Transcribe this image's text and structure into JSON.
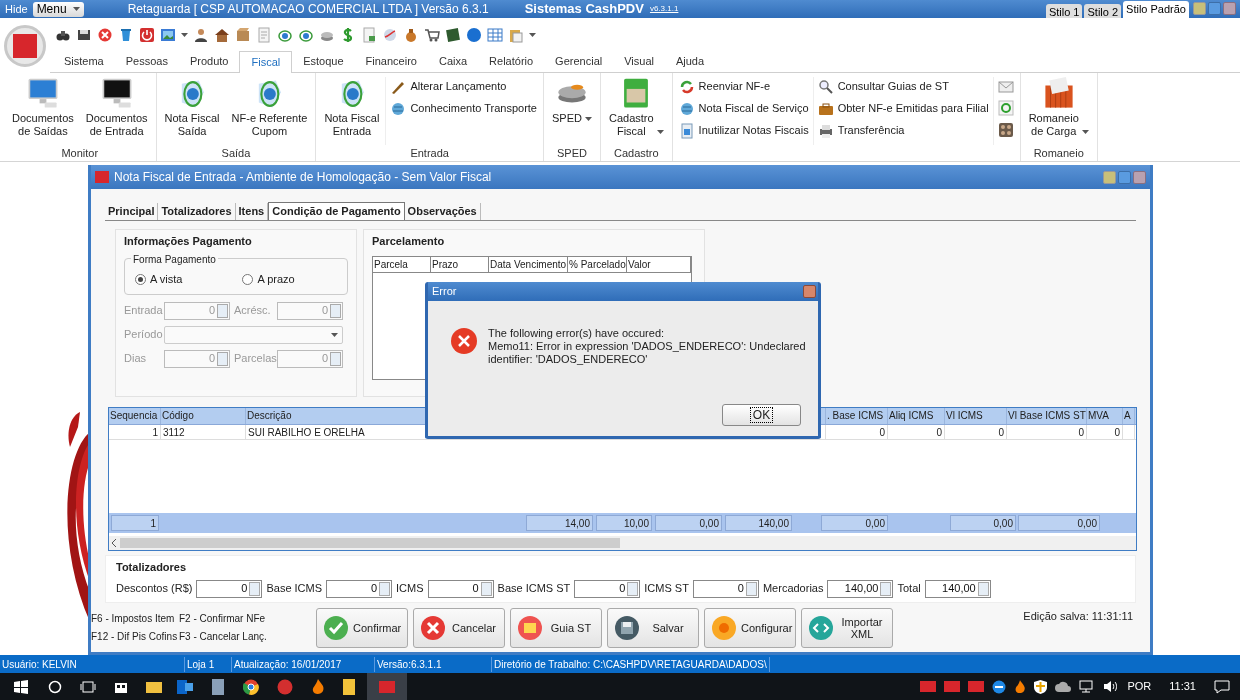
{
  "app": {
    "hide": "Hide",
    "menu": "Menu",
    "title": "Retaguarda [ CSP AUTOMACAO COMERCIAL LTDA ] Versão 6.3.1",
    "brand": "Sistemas CashPDV",
    "version_link": "v6.3.1.1"
  },
  "style_tabs": [
    {
      "label": "Stilo 1",
      "selected": false
    },
    {
      "label": "Stilo 2",
      "selected": false
    },
    {
      "label": "Stilo Padrão",
      "selected": true
    }
  ],
  "ribbon_tabs": [
    {
      "label": "Sistema",
      "selected": false
    },
    {
      "label": "Pessoas",
      "selected": false
    },
    {
      "label": "Produto",
      "selected": false
    },
    {
      "label": "Fiscal",
      "selected": true
    },
    {
      "label": "Estoque",
      "selected": false
    },
    {
      "label": "Financeiro",
      "selected": false
    },
    {
      "label": "Caixa",
      "selected": false
    },
    {
      "label": "Relatório",
      "selected": false
    },
    {
      "label": "Gerencial",
      "selected": false
    },
    {
      "label": "Visual",
      "selected": false
    },
    {
      "label": "Ajuda",
      "selected": false
    }
  ],
  "ribbon_groups": [
    {
      "label": "Monitor",
      "items": [
        {
          "kind": "large",
          "label": "Documentos\nde Saídas"
        },
        {
          "kind": "large",
          "label": "Documentos\nde Entrada"
        }
      ]
    },
    {
      "label": "Saída",
      "items": [
        {
          "kind": "large",
          "label": "Nota Fiscal\nSaída"
        },
        {
          "kind": "large",
          "label": "NF-e Referente\nCupom"
        }
      ]
    },
    {
      "label": "Entrada",
      "items": [
        {
          "kind": "large",
          "label": "Nota Fiscal\nEntrada"
        },
        {
          "kind": "small",
          "label": "Alterar Lançamento"
        },
        {
          "kind": "small",
          "label": "Conhecimento Transporte"
        }
      ]
    },
    {
      "label": "SPED",
      "items": [
        {
          "kind": "large",
          "label": "SPED",
          "dropdown": true
        }
      ]
    },
    {
      "label": "Cadastro",
      "items": [
        {
          "kind": "large",
          "label": "Cadastro\nFiscal",
          "dropdown": true
        }
      ]
    },
    {
      "items": [
        {
          "kind": "small",
          "label": "Reenviar NF-e"
        },
        {
          "kind": "small",
          "label": "Nota Fiscal de Serviço"
        },
        {
          "kind": "small",
          "label": "Inutilizar Notas Fiscais"
        },
        {
          "kind": "small",
          "label": "Consultar Guias de ST"
        },
        {
          "kind": "small",
          "label": "Obter NF-e Emitidas para Filial"
        },
        {
          "kind": "small",
          "label": "Transferência"
        },
        {
          "kind": "icon"
        },
        {
          "kind": "icon"
        },
        {
          "kind": "icon"
        }
      ]
    },
    {
      "label": "Romaneio",
      "items": [
        {
          "kind": "large",
          "label": "Romaneio\nde Carga",
          "dropdown": true
        }
      ]
    }
  ],
  "window": {
    "title": "Nota Fiscal de Entrada - Ambiente de Homologação - Sem Valor Fiscal"
  },
  "tabs": [
    {
      "label": "Principal",
      "selected": false
    },
    {
      "label": "Totalizadores",
      "selected": false
    },
    {
      "label": "Itens",
      "selected": false
    },
    {
      "label": "Condição de Pagamento",
      "selected": true
    },
    {
      "label": "Observações",
      "selected": false
    }
  ],
  "payment_info": {
    "title": "Informações Pagamento",
    "disabled": true,
    "forma_title": "Forma Pagamento",
    "options": [
      {
        "label": "A vista",
        "selected": true
      },
      {
        "label": "A prazo",
        "selected": false
      }
    ],
    "fields": [
      {
        "label": "Entrada",
        "value": "0"
      },
      {
        "label": "Acrésc.",
        "value": "0"
      },
      {
        "label": "Período"
      },
      {
        "label": "Dias",
        "value": "0"
      },
      {
        "label": "Parcelas",
        "value": "0"
      }
    ]
  },
  "installments": {
    "title": "Parcelamento",
    "columns": [
      "Parcela",
      "Prazo",
      "Data Vencimento",
      "% Parcelado",
      "Valor"
    ]
  },
  "items_grid": {
    "columns": [
      "Sequencia",
      "Código",
      "Descrição",
      ". Base ICMS",
      "Aliq ICMS",
      "Vl ICMS",
      "Vl Base ICMS ST",
      "MVA",
      "A"
    ],
    "rows": [
      {
        "cells": [
          "1",
          "3112",
          "SUI RABILHO E ORELHA",
          "0",
          "0",
          "0",
          "0",
          "0"
        ]
      }
    ],
    "totals": [
      "1",
      "14,00",
      "10,00",
      "0,00",
      "140,00",
      "0,00",
      "0,00",
      "0,00"
    ]
  },
  "totalizers": {
    "title": "Totalizadores",
    "fields": [
      {
        "label": "Descontos (R$)",
        "value": "0"
      },
      {
        "label": "Base ICMS",
        "value": "0"
      },
      {
        "label": "ICMS",
        "value": "0"
      },
      {
        "label": "Base ICMS ST",
        "value": "0"
      },
      {
        "label": "ICMS ST",
        "value": "0"
      },
      {
        "label": "Mercadorias",
        "value": "140,00"
      },
      {
        "label": "Total",
        "value": "140,00"
      }
    ]
  },
  "shortcuts": [
    "F6 - Impostos Item",
    "F2 - Confirmar NFe",
    "F12 - Dif Pis Cofins",
    "F3 - Cancelar Lanç."
  ],
  "actions": [
    "Confirmar",
    "Cancelar",
    "Guia ST",
    "Salvar",
    "Configurar",
    "Importar\nXML"
  ],
  "save_status": "Edição salva: 11:31:11",
  "dialog": {
    "title": "Error",
    "message": "The following error(s) have occured:\nMemo11: Error in expression 'DADOS_ENDERECO': Undeclared\nidentifier: 'DADOS_ENDERECO'",
    "button": "OK"
  },
  "status_bar": [
    "Usuário: KELVIN",
    "Loja 1",
    "Atualização:  16/01/2017",
    "Versão:6.3.1.1",
    "Diretório de Trabalho: C:\\CASHPDV\\RETAGUARDA\\DADOS\\"
  ],
  "taskbar": {
    "language": "POR",
    "time": "11:31"
  }
}
